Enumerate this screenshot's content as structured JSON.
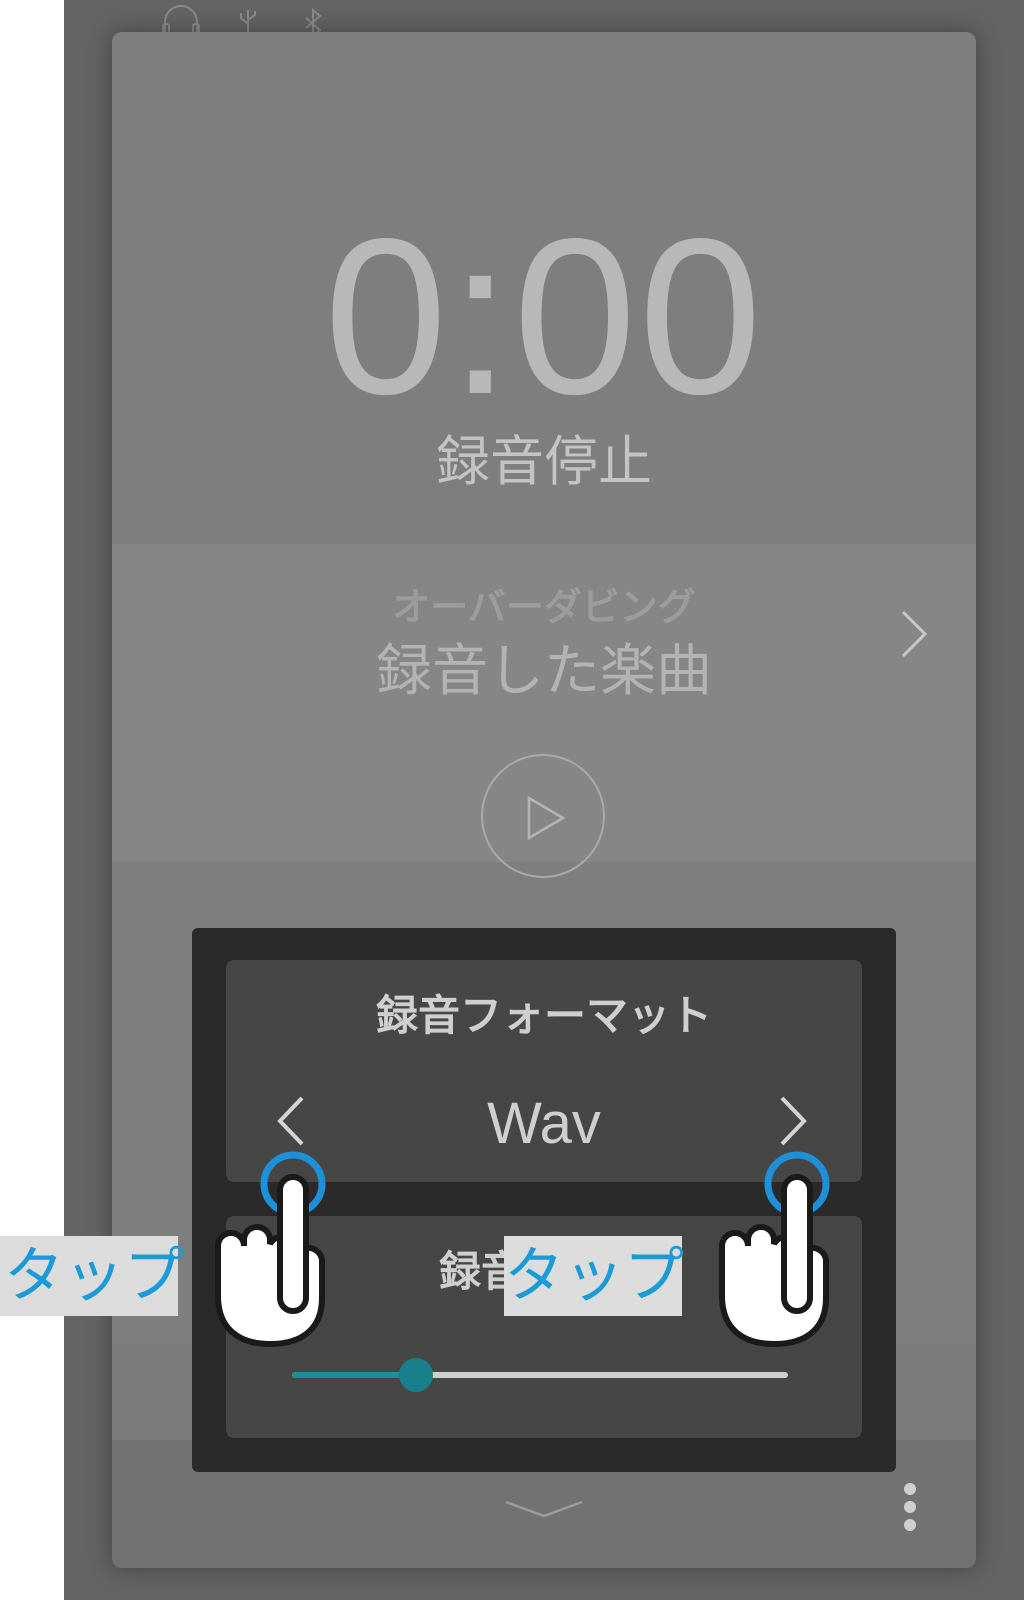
{
  "timer": {
    "display": "0:00",
    "status": "録音停止"
  },
  "overdubbing": {
    "label": "オーバーダビング",
    "song_title": "録音した楽曲"
  },
  "popup": {
    "format": {
      "title": "録音フォーマット",
      "value": "Wav"
    },
    "level": {
      "title": "録音レベル",
      "fraction": 0.25
    }
  },
  "annotations": {
    "tap_left": "タップ",
    "tap_right": "タップ"
  },
  "icons": [
    "headphones-icon",
    "usb-icon",
    "bluetooth-icon",
    "chevron-right-icon",
    "play-icon",
    "chevron-down-icon",
    "more-vertical-icon",
    "chevron-left-icon",
    "hand-pointer-icon"
  ],
  "colors": {
    "accent": "#1a8f99",
    "tap_text": "#1a9bd7",
    "tap_ring": "#1e90d8"
  }
}
